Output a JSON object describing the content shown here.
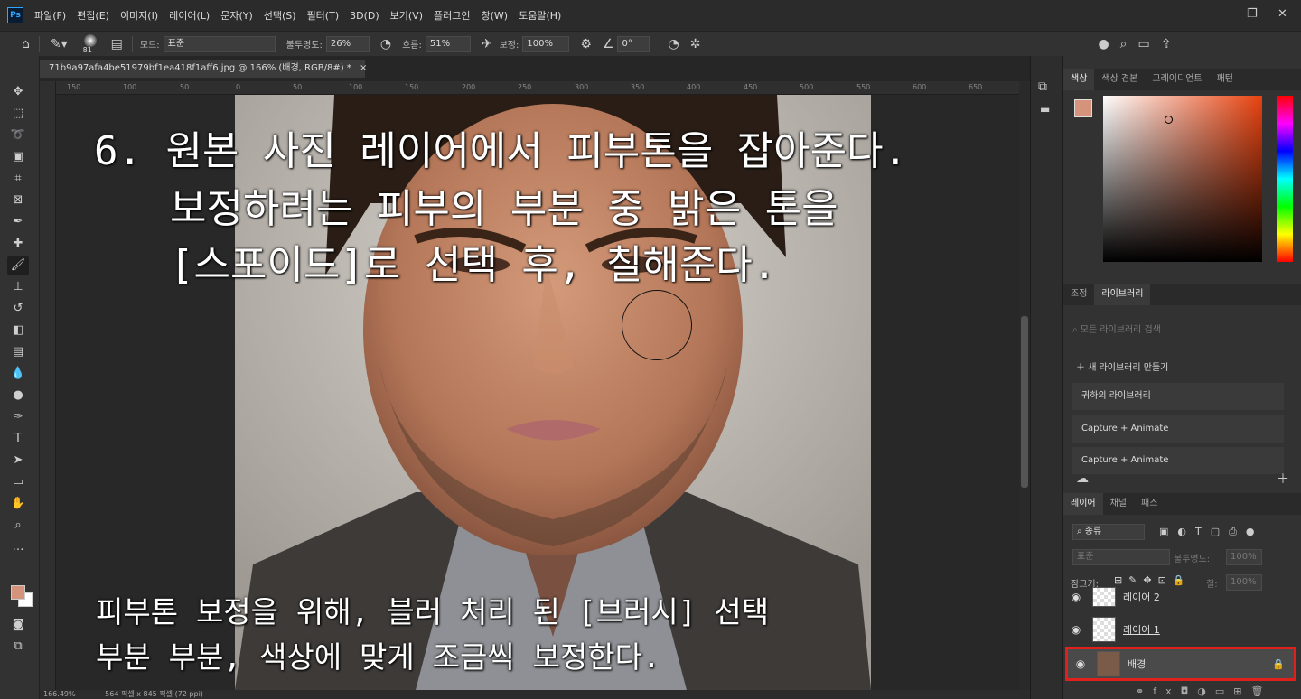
{
  "menu": {
    "items": [
      "파일(F)",
      "편집(E)",
      "이미지(I)",
      "레이어(L)",
      "문자(Y)",
      "선택(S)",
      "필터(T)",
      "3D(D)",
      "보기(V)",
      "플러그인",
      "창(W)",
      "도움말(H)"
    ]
  },
  "options": {
    "brush_size": "81",
    "mode_label": "모드:",
    "mode_value": "표준",
    "opacity_label": "불투명도:",
    "opacity_value": "26%",
    "flow_label": "흐름:",
    "flow_value": "51%",
    "smoothing_label": "보정:",
    "smoothing_value": "100%",
    "angle_value": "0°"
  },
  "document": {
    "tab_title": "71b9a97afa4be51979bf1ea418f1aff6.jpg @ 166% (배경, RGB/8#) *",
    "zoom": "166.49%",
    "size_info": "564 픽셀 x 845 픽셀 (72 ppi)"
  },
  "ruler_ticks": [
    "150",
    "100",
    "50",
    "0",
    "50",
    "100",
    "150",
    "200",
    "250",
    "300",
    "350",
    "400",
    "450",
    "500",
    "550",
    "600",
    "650"
  ],
  "overlay": {
    "line1": "6. 원본 사진 레이어에서 피부톤을 잡아준다.",
    "line2": "보정하려는 피부의 부분 중 밝은 톤을",
    "line3": "[스포이드]로 선택 후, 칠해준다.",
    "bottom1": "피부톤 보정을 위해, 블러 처리 된 [브러시] 선택",
    "bottom2": "부분 부분, 색상에 맞게 조금씩 보정한다."
  },
  "color_panel": {
    "tabs": [
      "색상",
      "색상 견본",
      "그레이디언트",
      "패턴"
    ],
    "foreground": "#d4937a"
  },
  "library_panel": {
    "tabs": [
      "조정",
      "라이브러리"
    ],
    "search_placeholder": "모든 라이브러리 검색",
    "new_library": "새 라이브러리 만들기",
    "items": [
      "귀하의 라이브러리",
      "Capture + Animate",
      "Capture + Animate"
    ]
  },
  "layers_panel": {
    "tabs": [
      "레이어",
      "채널",
      "패스"
    ],
    "kind_filter": "종류",
    "blend_mode": "표준",
    "opacity_label": "불투명도:",
    "opacity_value": "100%",
    "lock_label": "잠그기:",
    "fill_label": "칠:",
    "fill_value": "100%",
    "layers": [
      "레이어 2",
      "레이어 1",
      "배경"
    ]
  },
  "colors": {
    "accent": "#31a8ff",
    "selected_layer_border": "#e0201c"
  }
}
